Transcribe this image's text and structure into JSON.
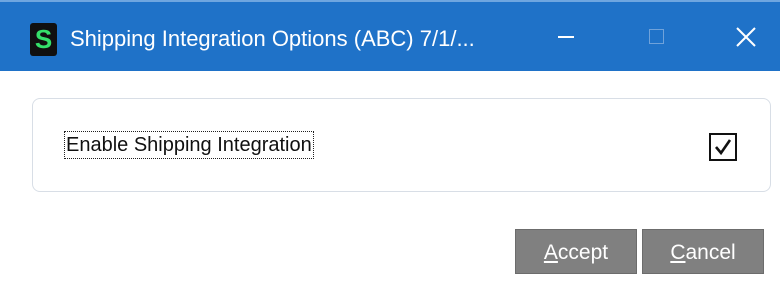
{
  "window": {
    "title": "Shipping Integration Options (ABC) 7/1/...",
    "app_icon_letter": "S",
    "minimize_glyph": "—",
    "close_glyph": "✕"
  },
  "options": {
    "enable_shipping_integration_label": "Enable Shipping Integration",
    "enable_shipping_integration_checked": true
  },
  "buttons": {
    "accept_mnemonic": "A",
    "accept_rest": "ccept",
    "cancel_mnemonic": "C",
    "cancel_rest": "ancel"
  },
  "colors": {
    "title_bar": "#1f72c8",
    "button_bg": "#808080",
    "app_icon_letter": "#35e06a"
  }
}
